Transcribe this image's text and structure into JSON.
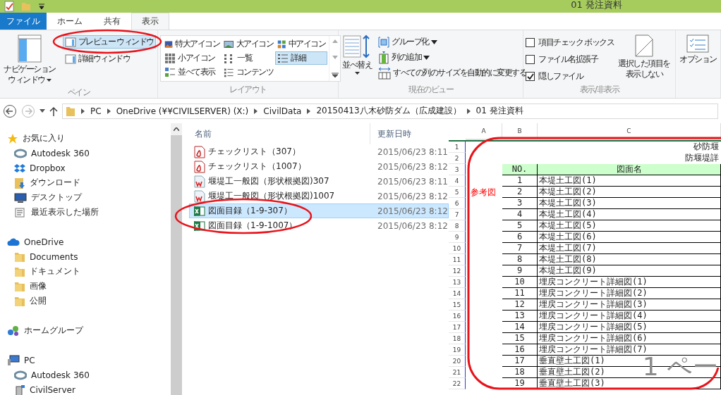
{
  "window": {
    "title": "01 発注資料"
  },
  "tabs": [
    {
      "label": "ファイル",
      "kind": "file",
      "selected": false
    },
    {
      "label": "ホーム",
      "kind": "tab",
      "selected": false
    },
    {
      "label": "共有",
      "kind": "tab",
      "selected": false
    },
    {
      "label": "表示",
      "kind": "tab",
      "selected": true
    }
  ],
  "ribbon": {
    "pane": {
      "label": "ペイン",
      "navigation": [
        "ナビゲーション",
        "ウィンドウ"
      ],
      "items": [
        {
          "label": "プレビュー ウィンドウ",
          "selected": true
        },
        {
          "label": "詳細ウィンドウ",
          "selected": false
        }
      ]
    },
    "layout": {
      "label": "レイアウト",
      "items": [
        {
          "label": "特大アイコン",
          "kind": "xl",
          "selected": false
        },
        {
          "label": "大アイコン",
          "kind": "large",
          "selected": false
        },
        {
          "label": "中アイコン",
          "kind": "medium",
          "selected": false
        },
        {
          "label": "小アイコン",
          "kind": "small",
          "selected": false
        },
        {
          "label": "一覧",
          "kind": "list",
          "selected": false
        },
        {
          "label": "詳細",
          "kind": "details",
          "selected": true
        },
        {
          "label": "並べて表示",
          "kind": "tiles",
          "selected": false
        },
        {
          "label": "コンテンツ",
          "kind": "content",
          "selected": false
        }
      ]
    },
    "current_view": {
      "label": "現在のビュー",
      "sort": "並べ替え",
      "items": [
        {
          "label": "グループ化",
          "kind": "group",
          "dropdown": true
        },
        {
          "label": "列の追加",
          "kind": "addcol",
          "dropdown": true
        },
        {
          "label": "すべての列のサイズを自動的に変更する",
          "kind": "fit",
          "dropdown": false
        }
      ]
    },
    "show_hide": {
      "label": "表示/非表示",
      "checkboxes": [
        {
          "label": "項目チェック ボックス",
          "checked": false
        },
        {
          "label": "ファイル名拡張子",
          "checked": false
        },
        {
          "label": "隠しファイル",
          "checked": true
        }
      ],
      "hide_selected": [
        "選択した項目を",
        "表示しない"
      ]
    },
    "options": {
      "label": "オプション"
    }
  },
  "address": {
    "segments": [
      "PC",
      "OneDrive (¥¥CIVILSERVER) (X:)",
      "CivilData",
      "20150413八木砂防ダム（広成建設）",
      "01 発注資料"
    ]
  },
  "navigation": [
    {
      "label": "お気に入り",
      "kind": "star",
      "children": [
        {
          "label": "Autodesk 360",
          "kind": "a360"
        },
        {
          "label": "Dropbox",
          "kind": "dropbox"
        },
        {
          "label": "ダウンロード",
          "kind": "download"
        },
        {
          "label": "デスクトップ",
          "kind": "desktop"
        },
        {
          "label": "最近表示した場所",
          "kind": "recent"
        }
      ]
    },
    {
      "label": "OneDrive",
      "kind": "cloud",
      "children": [
        {
          "label": "Documents",
          "kind": "folder"
        },
        {
          "label": "ドキュメント",
          "kind": "folder"
        },
        {
          "label": "画像",
          "kind": "folder"
        },
        {
          "label": "公開",
          "kind": "folder"
        }
      ]
    },
    {
      "label": "ホームグループ",
      "kind": "homegroup"
    },
    {
      "label": "PC",
      "kind": "pc",
      "children": [
        {
          "label": "Autodesk 360",
          "kind": "a360"
        },
        {
          "label": "CivilServer",
          "kind": "server"
        }
      ]
    }
  ],
  "files": {
    "columns": [
      "名前",
      "更新日時"
    ],
    "rows": [
      {
        "kind": "pdf",
        "name": "チェックリスト（307）",
        "date": "2015/06/23 8:11",
        "selected": false
      },
      {
        "kind": "pdf",
        "name": "チェックリスト（1007）",
        "date": "2015/06/23 8:12",
        "selected": false
      },
      {
        "kind": "dw",
        "name": "堰堤工一般図（形状根拠図)307",
        "date": "2015/06/23 8:11",
        "selected": false
      },
      {
        "kind": "dw",
        "name": "堰堤工一般図（形状根拠図)1007",
        "date": "2015/06/23 8:12",
        "selected": false
      },
      {
        "kind": "excel",
        "name": "図面目録（1-9-307）",
        "date": "2015/06/23 8:12",
        "selected": true
      },
      {
        "kind": "excel",
        "name": "図面目録（1-9-1007）",
        "date": "2015/06/23 8:12",
        "selected": false
      }
    ]
  },
  "preview": {
    "columns": [
      "A",
      "B",
      "C"
    ],
    "row_numbers": [
      "1",
      "2",
      "3",
      "4",
      "5",
      "6",
      "7",
      "8",
      "9",
      "10",
      "11",
      "12",
      "13",
      "14",
      "15",
      "16",
      "17",
      "18",
      "19",
      "20",
      "21",
      "22"
    ],
    "title_lines": [
      "砂防堰",
      "防堰堤詳"
    ],
    "header": [
      "NO.",
      "図面名"
    ],
    "rows": [
      {
        "no": "1",
        "name": "本堤土工図(1)"
      },
      {
        "no": "2",
        "name": "本堤土工図(2)",
        "note": "参考図"
      },
      {
        "no": "3",
        "name": "本堤土工図(3)"
      },
      {
        "no": "4",
        "name": "本堤土工図(4)"
      },
      {
        "no": "5",
        "name": "本堤土工図(5)"
      },
      {
        "no": "6",
        "name": "本堤土工図(6)"
      },
      {
        "no": "7",
        "name": "本堤土工図(7)"
      },
      {
        "no": "8",
        "name": "本堤土工図(8)"
      },
      {
        "no": "9",
        "name": "本堤土工図(9)"
      },
      {
        "no": "10",
        "name": "埋戻コンクリート詳細図(1)"
      },
      {
        "no": "11",
        "name": "埋戻コンクリート詳細図(2)"
      },
      {
        "no": "12",
        "name": "埋戻コンクリート詳細図(3)"
      },
      {
        "no": "13",
        "name": "埋戻コンクリート詳細図(4)"
      },
      {
        "no": "14",
        "name": "埋戻コンクリート詳細図(5)"
      },
      {
        "no": "15",
        "name": "埋戻コンクリート詳細図(6)"
      },
      {
        "no": "16",
        "name": "埋戻コンクリート詳細図(7)"
      },
      {
        "no": "17",
        "name": "垂直壁土工図(1)"
      },
      {
        "no": "18",
        "name": "垂直壁土工図(2)"
      },
      {
        "no": "19",
        "name": "垂直壁土工図(3)"
      }
    ],
    "page_label": "1 ペー"
  }
}
